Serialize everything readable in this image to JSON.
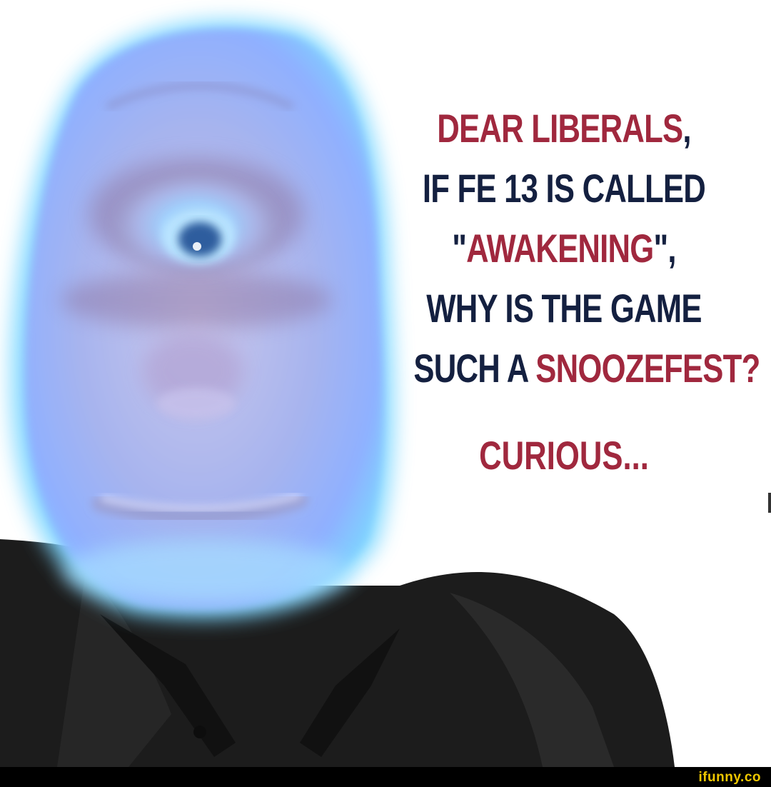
{
  "caption": {
    "line1_navy": "DEAR LIBERALS",
    "line1_red": "",
    "line1_comma": ",",
    "line2": "IF FE 13 IS CALLED",
    "line3_quote_open": "\"",
    "line3_red": "AWAKENING",
    "line3_tail": "\",",
    "line4": "WHY IS THE GAME",
    "line5_navy": "SUCH A ",
    "line5_red": "SNOOZEFEST",
    "line5_end": "?",
    "sign_off": "CURIOUS..."
  },
  "colors": {
    "navy": "#142040",
    "red": "#a0283e",
    "face_glow": "#8fb6ff",
    "shirt": "#1c1c1c",
    "watermark": "#f0c800"
  },
  "watermark": "ifunny.co"
}
